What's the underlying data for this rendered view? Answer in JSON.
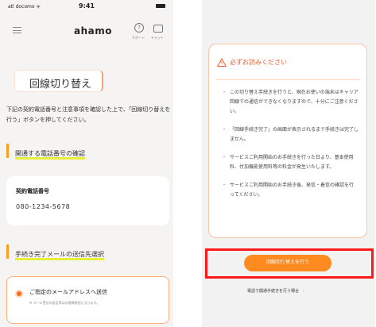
{
  "left": {
    "status": {
      "carrier": "atl docomo ᯤ",
      "time": "9:41"
    },
    "header": {
      "logo": "ahamo",
      "support_label": "サポート",
      "chat_label": "チャット",
      "support_icon": "question-icon",
      "chat_icon": "chat-icon"
    },
    "page_title": "回線切り替え",
    "lead": "下記の契約電話番号と注意事項を確認した上で、「回線切り替えを行う」ボタンを押してください。",
    "section1": "開通する電話番号の確認",
    "contract": {
      "label": "契約電話番号",
      "number": "080-1234-5678"
    },
    "section2": "手続き完了メールの送信先選択",
    "option": {
      "title": "ご指定のメールアドレスへ送信",
      "note": "※ メール受信の設定等はお客様負担になります。"
    }
  },
  "right": {
    "notice": {
      "title": "必ずお読みください",
      "items": [
        "この切り替え手続きを行うと、現在お使いの端末はキャリア回線での通信ができなくなりますので、十分にご注意ください。",
        "「回線手続き完了」の画面が表示されるまで手続きは完了しません。",
        "サービスご利用開始のお手続きを行った日より、基本使用料、付加機能使用料等の料金が発生いたします。",
        "サービスご利用開始のお手続き後、発信・着信の確認を行ってください。"
      ]
    },
    "cta": "回線切り替えを行う",
    "phone_link": "電話で開通手続きを行う場合"
  },
  "colors": {
    "accent": "#ff8a1f",
    "warning": "#f35c2d",
    "highlight": "#e7ef3b",
    "red_frame": "#ff1a1a"
  }
}
